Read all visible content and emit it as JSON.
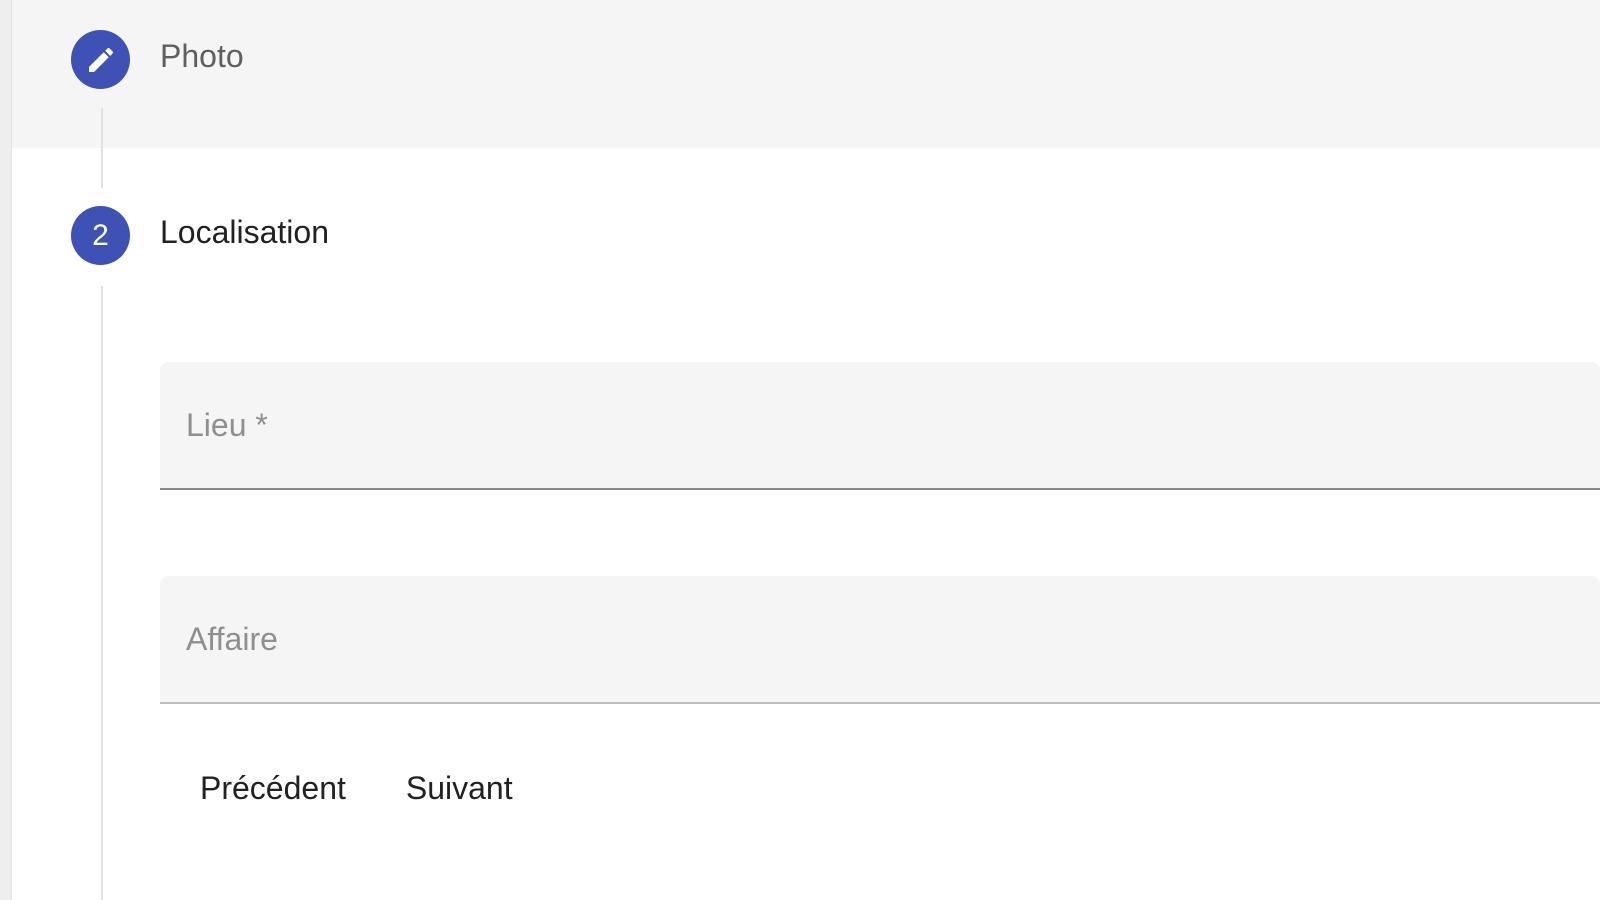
{
  "stepper": {
    "steps": [
      {
        "label": "Photo",
        "state": "completed",
        "icon": "pencil-icon"
      },
      {
        "label": "Localisation",
        "state": "active",
        "number": "2"
      }
    ]
  },
  "form": {
    "lieu": {
      "placeholder": "Lieu *",
      "value": ""
    },
    "affaire": {
      "placeholder": "Affaire",
      "value": ""
    }
  },
  "actions": {
    "previous_label": "Précédent",
    "next_label": "Suivant"
  },
  "colors": {
    "accent": "#3f51b5",
    "completed_header_bg": "#f5f5f5",
    "field_bg": "#f5f5f5"
  }
}
